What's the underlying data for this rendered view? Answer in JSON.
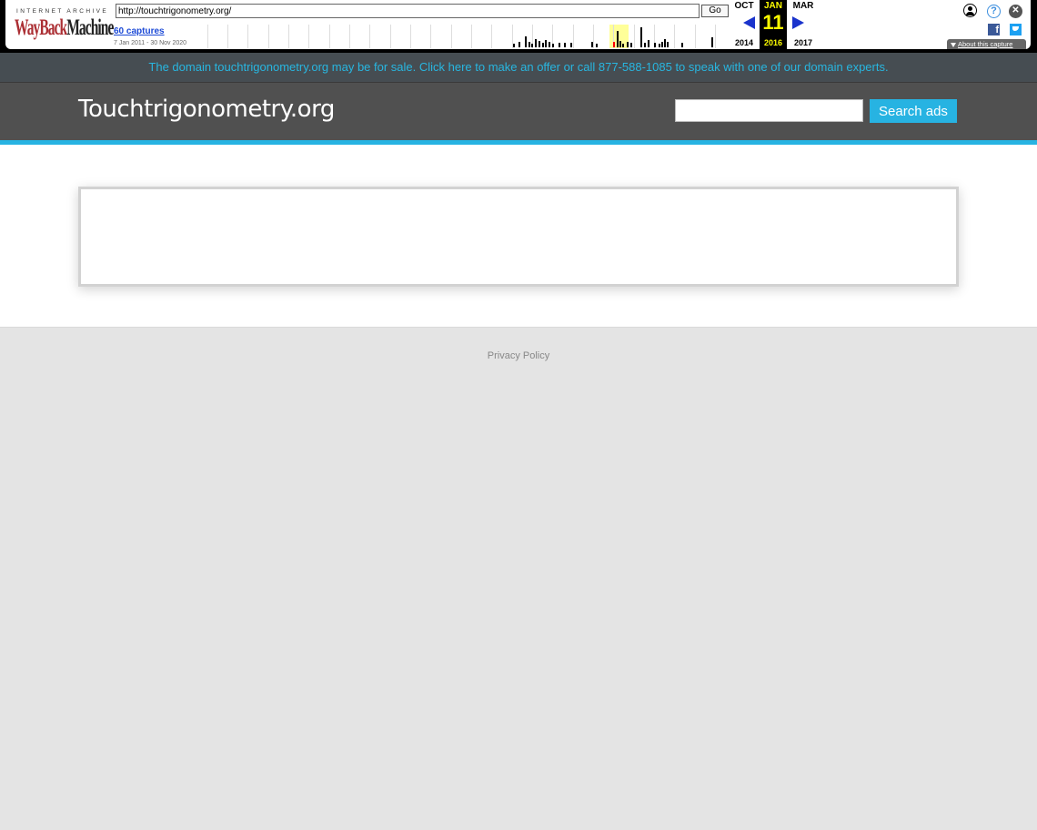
{
  "wayback": {
    "logo_top": "INTERNET ARCHIVE",
    "logo_wayback": "WayBack",
    "logo_machine": "Machine",
    "url": "http://touchtrigonometry.org/",
    "go_label": "Go",
    "captures_label": "60 captures",
    "date_range": "7 Jan 2011 - 30 Nov 2020",
    "prev_month": "OCT",
    "current_month": "JAN",
    "next_month": "MAR",
    "current_day": "11",
    "prev_year": "2014",
    "current_year": "2016",
    "next_year": "2017",
    "about_label": "About this capture",
    "facebook_letter": "f",
    "help_glyph": "?",
    "close_glyph": "✕"
  },
  "sale_banner": "The domain touchtrigonometry.org may be for sale. Click here to make an offer or call 877-588-1085 to speak with one of our domain experts.",
  "header": {
    "site_title": "Touchtrigonometry.org",
    "search_value": "",
    "search_button": "Search ads"
  },
  "footer": {
    "privacy": "Privacy Policy"
  },
  "colors": {
    "accent": "#27b3e2",
    "header_bg": "#505050",
    "banner_bg": "#464d52",
    "page_bg": "#e4e4e4"
  }
}
